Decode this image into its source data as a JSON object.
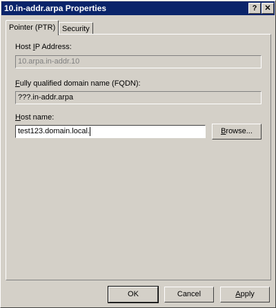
{
  "window": {
    "title": "10.in-addr.arpa Properties"
  },
  "titlebar": {
    "help_glyph": "?",
    "close_glyph": "✕"
  },
  "tabs": [
    {
      "label": "Pointer (PTR)",
      "active": true
    },
    {
      "label": "Security",
      "active": false
    }
  ],
  "form": {
    "host_ip_label_pre": "Host ",
    "host_ip_label_u": "I",
    "host_ip_label_post": "P Address:",
    "host_ip_value": "10.arpa.in-addr.10",
    "fqdn_label_u": "F",
    "fqdn_label_post": "ully qualified domain name (FQDN):",
    "fqdn_value": "???.in-addr.arpa",
    "host_name_label_u": "H",
    "host_name_label_post": "ost name:",
    "host_name_value": "test123.domain.local.",
    "browse_u": "B",
    "browse_post": "rowse..."
  },
  "footer": {
    "ok_label": "OK",
    "cancel_label": "Cancel",
    "apply_u": "A",
    "apply_post": "pply"
  }
}
